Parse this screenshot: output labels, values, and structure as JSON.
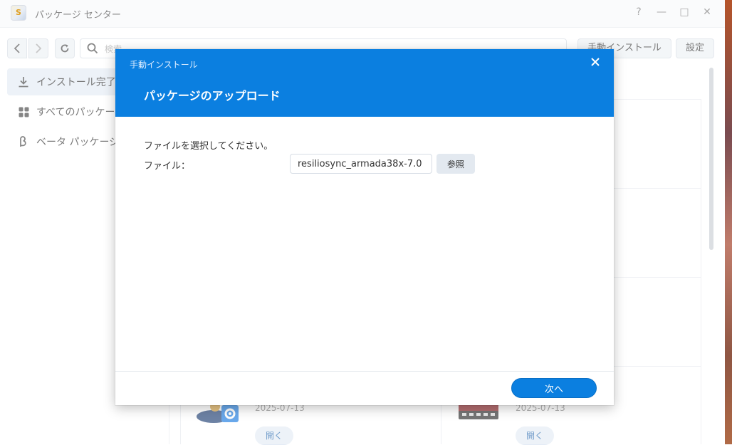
{
  "window": {
    "title": "パッケージ センター",
    "app_icon_letter": "S",
    "controls": {
      "help": "?",
      "minimize": "—",
      "maximize": "□",
      "close": "✕"
    }
  },
  "toolbar": {
    "search_placeholder": "検索",
    "manual_install_label": "手動インストール",
    "settings_label": "設定"
  },
  "sidebar": {
    "items": [
      {
        "label": "インストール完了",
        "icon": "download-icon",
        "active": true
      },
      {
        "label": "すべてのパッケージ",
        "icon": "grid-icon",
        "active": false
      },
      {
        "label": "ベータ パッケージ",
        "icon": "beta-icon",
        "active": false
      }
    ]
  },
  "packages": [
    {
      "date": "2025-07-13",
      "action": "開く",
      "icon": "user-gear-icon"
    },
    {
      "date": "2025-07-13",
      "action": "開く",
      "icon": "video-station-icon"
    }
  ],
  "dialog": {
    "window_title": "手動インストール",
    "heading": "パッケージのアップロード",
    "instruction": "ファイルを選択してください。",
    "file_label": "ファイル：",
    "file_value": "resiliosync_armada38x-7.0",
    "browse_label": "参照",
    "next_label": "次へ"
  },
  "colors": {
    "accent": "#0b7fe0",
    "sidebar_active": "#e3ebf5"
  }
}
